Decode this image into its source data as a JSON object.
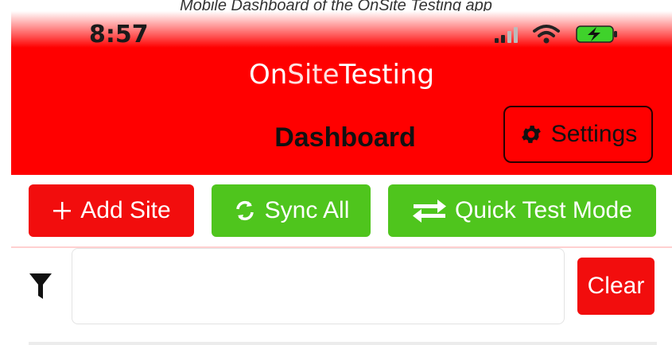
{
  "caption": "Mobile Dashboard of the OnSite Testing app",
  "status_bar": {
    "time": "8:57",
    "icons": [
      "signal-icon",
      "wifi-icon",
      "battery-charging-icon"
    ]
  },
  "header": {
    "app_name_part1": "On",
    "app_name_part2": "Site",
    "app_name_part3": "Testing",
    "page_title": "Dashboard",
    "settings_label": "Settings",
    "settings_icon": "gear-icon"
  },
  "toolbar": {
    "add_site_label": "Add Site",
    "sync_all_label": "Sync All",
    "quick_test_label": "Quick Test Mode"
  },
  "filter": {
    "icon": "filter-icon",
    "value": "",
    "clear_label": "Clear"
  },
  "colors": {
    "brand_red": "#ff0000",
    "button_red": "#f20d0d",
    "button_green": "#4fc51d",
    "white": "#ffffff"
  }
}
